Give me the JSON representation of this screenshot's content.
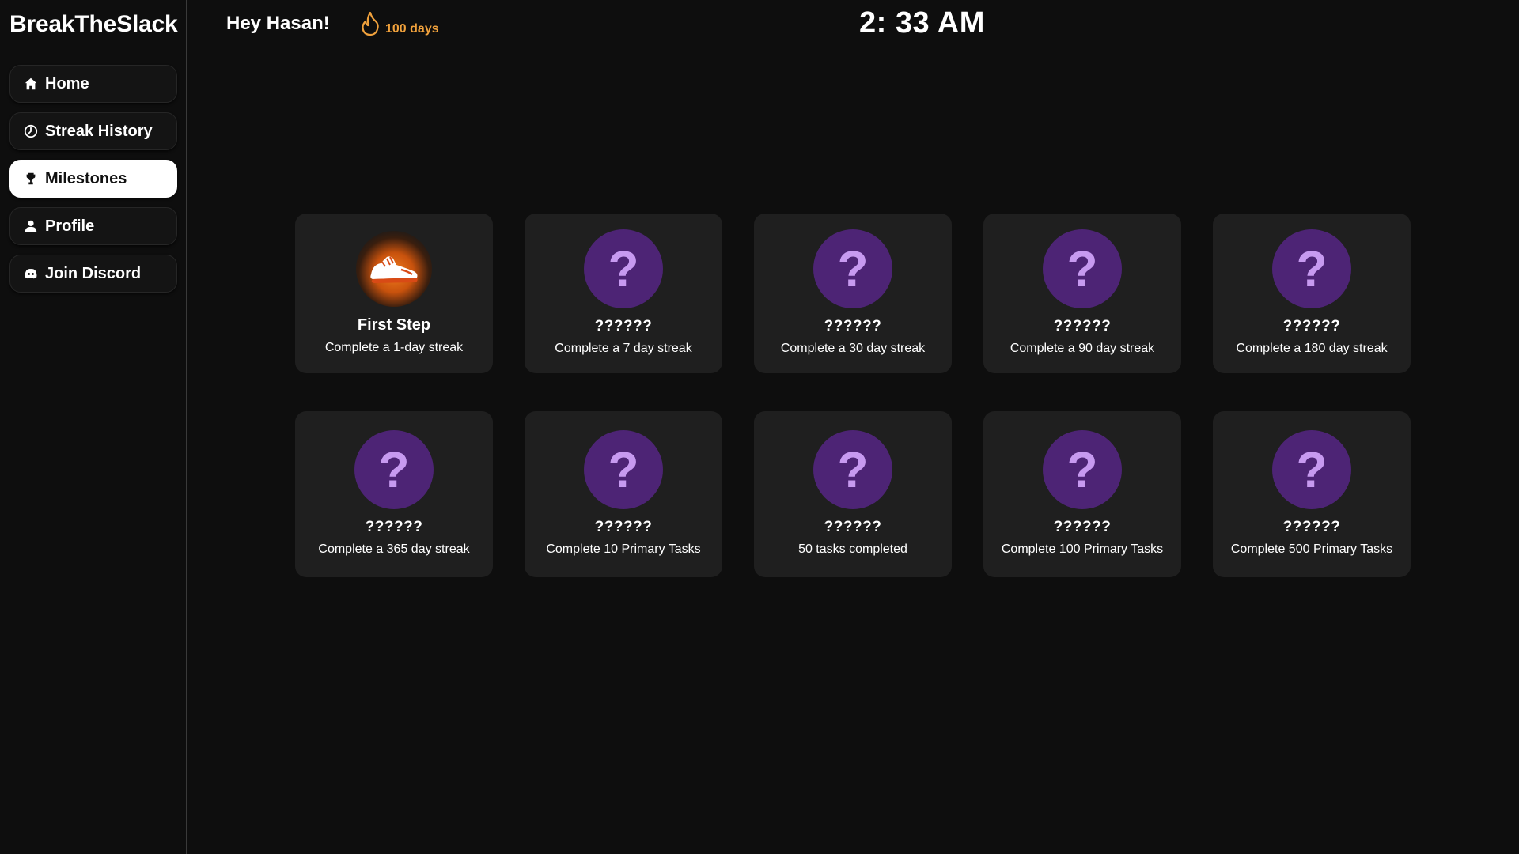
{
  "app": {
    "brand": "BreakTheSlack"
  },
  "sidebar": {
    "items": [
      {
        "label": "Home",
        "icon": "home-icon",
        "active": false
      },
      {
        "label": "Streak History",
        "icon": "clock-icon",
        "active": false
      },
      {
        "label": "Milestones",
        "icon": "trophy-icon",
        "active": true
      },
      {
        "label": "Profile",
        "icon": "user-icon",
        "active": false
      },
      {
        "label": "Join Discord",
        "icon": "discord-icon",
        "active": false
      }
    ]
  },
  "header": {
    "greeting": "Hey Hasan!",
    "streak_label": "100 days",
    "streak_icon": "flame-icon",
    "time": "2: 33 AM"
  },
  "colors": {
    "accent_streak": "#f0a13c",
    "locked_badge": "#4d2475",
    "locked_glyph": "#c79af0",
    "card_bg": "#1f1f1f"
  },
  "milestones": [
    {
      "title": "First Step",
      "desc": "Complete a 1-day streak",
      "earned": true,
      "icon": "sneaker-icon"
    },
    {
      "title": "??????",
      "desc": "Complete a 7 day streak",
      "earned": false,
      "icon": "question-icon"
    },
    {
      "title": "??????",
      "desc": "Complete a 30 day streak",
      "earned": false,
      "icon": "question-icon"
    },
    {
      "title": "??????",
      "desc": "Complete a 90 day streak",
      "earned": false,
      "icon": "question-icon"
    },
    {
      "title": "??????",
      "desc": "Complete a 180 day streak",
      "earned": false,
      "icon": "question-icon"
    },
    {
      "title": "??????",
      "desc": "Complete a 365 day streak",
      "earned": false,
      "icon": "question-icon"
    },
    {
      "title": "??????",
      "desc": "Complete 10 Primary Tasks",
      "earned": false,
      "icon": "question-icon"
    },
    {
      "title": "??????",
      "desc": "50 tasks completed",
      "earned": false,
      "icon": "question-icon"
    },
    {
      "title": "??????",
      "desc": "Complete 100 Primary Tasks",
      "earned": false,
      "icon": "question-icon"
    },
    {
      "title": "??????",
      "desc": "Complete 500 Primary Tasks",
      "earned": false,
      "icon": "question-icon"
    }
  ],
  "locked_glyph": "?"
}
